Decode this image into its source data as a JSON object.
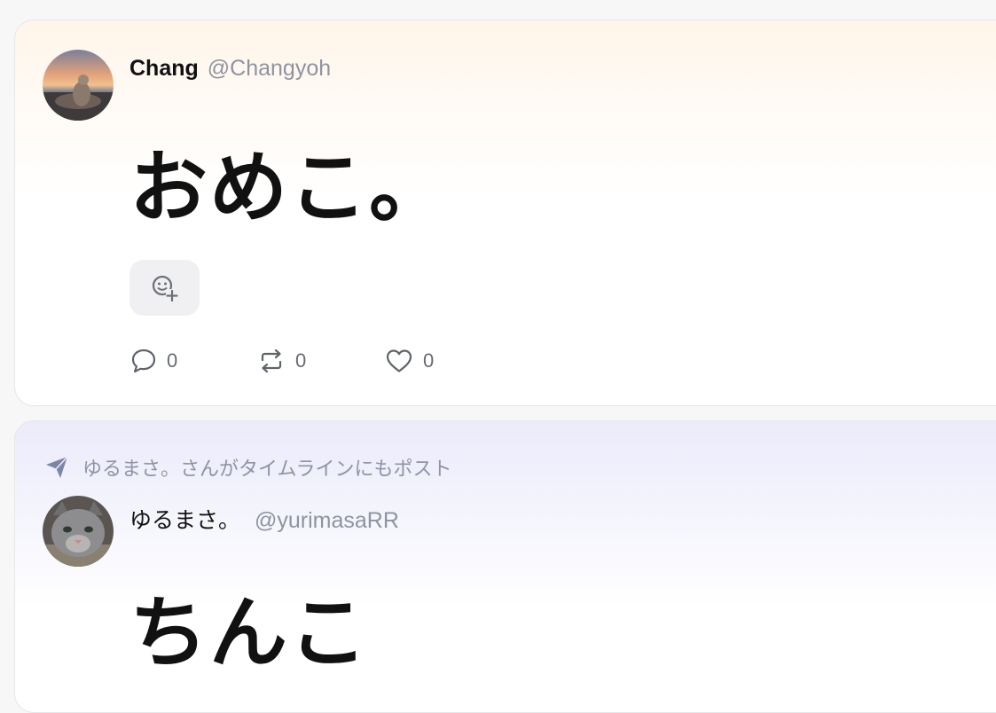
{
  "posts": [
    {
      "display_name": "Chang",
      "handle": "@Changyoh",
      "text": "おめこ。",
      "actions": {
        "replies": "0",
        "reposts": "0",
        "likes": "0"
      }
    },
    {
      "repost_note": "ゆるまさ。さんがタイムラインにもポスト",
      "display_name": "ゆるまさ。",
      "handle": "@yurimasaRR",
      "text": "ちんこ"
    }
  ]
}
